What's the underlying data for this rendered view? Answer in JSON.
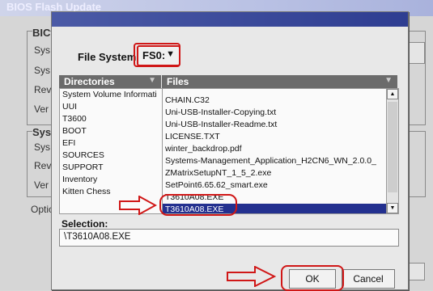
{
  "background_window": {
    "title": "BIOS Flash Update",
    "group1_title": "BIC",
    "group1_labels": [
      "BIC",
      "Sys",
      "Rev",
      "Ver"
    ],
    "group2_title": "Sys",
    "group2_labels": [
      "Sys",
      "Rev",
      "Ver"
    ],
    "option_label": "Optic"
  },
  "dialog": {
    "file_system": {
      "label": "File System:",
      "value": "FS0:"
    },
    "directories": {
      "header": "Directories",
      "items": [
        "System Volume Informati",
        "UUI",
        "T3600",
        "BOOT",
        "EFI",
        "SOURCES",
        "SUPPORT",
        "Inventory",
        "Kitten Chess"
      ]
    },
    "files": {
      "header": "Files",
      "items": [
        "CHAIN.C32",
        "Uni-USB-Installer-Copying.txt",
        "Uni-USB-Installer-Readme.txt",
        "LICENSE.TXT",
        "winter_backdrop.pdf",
        "Systems-Management_Application_H2CN6_WN_2.0.0_",
        "ZMatrixSetupNT_1_5_2.exe",
        "SetPoint6.65.62_smart.exe",
        "T3610A08.EXE",
        "T3610A08.EXE"
      ],
      "selected_index": 9
    },
    "selection": {
      "label": "Selection:",
      "value": "\\T3610A08.EXE"
    },
    "ok_label": "OK",
    "cancel_label": "Cancel"
  }
}
